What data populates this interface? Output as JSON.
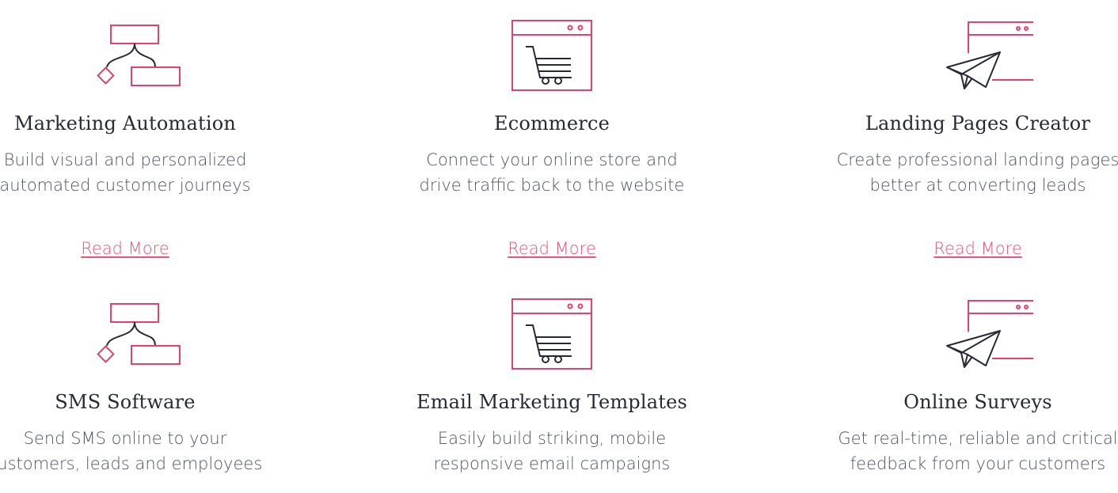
{
  "colors": {
    "accent": "#e8406a",
    "ink": "#262a36",
    "text": "#4f5460",
    "link": "#e8557a"
  },
  "features": [
    {
      "icon": "workflow-icon",
      "title": "Marketing Automation",
      "desc_line1": "Build visual and personalized",
      "desc_line2": "automated customer journeys",
      "link": "Read More"
    },
    {
      "icon": "shopping-cart-browser-icon",
      "title": "Ecommerce",
      "desc_line1": "Connect your online store and",
      "desc_line2": "drive traffic back to the website",
      "link": "Read More"
    },
    {
      "icon": "paper-plane-browser-icon",
      "title": "Landing Pages Creator",
      "desc_line1": "Create professional landing pages",
      "desc_line2": "better at converting leads",
      "link": "Read More"
    },
    {
      "icon": "workflow-icon",
      "title": "SMS Software",
      "desc_line1": "Send SMS online to your",
      "desc_line2": "customers, leads and employees"
    },
    {
      "icon": "shopping-cart-browser-icon",
      "title": "Email Marketing Templates",
      "desc_line1": "Easily build striking, mobile",
      "desc_line2": "responsive email campaigns"
    },
    {
      "icon": "paper-plane-browser-icon",
      "title": "Online Surveys",
      "desc_line1": "Get real-time, reliable and critical",
      "desc_line2": "feedback from your customers"
    }
  ]
}
